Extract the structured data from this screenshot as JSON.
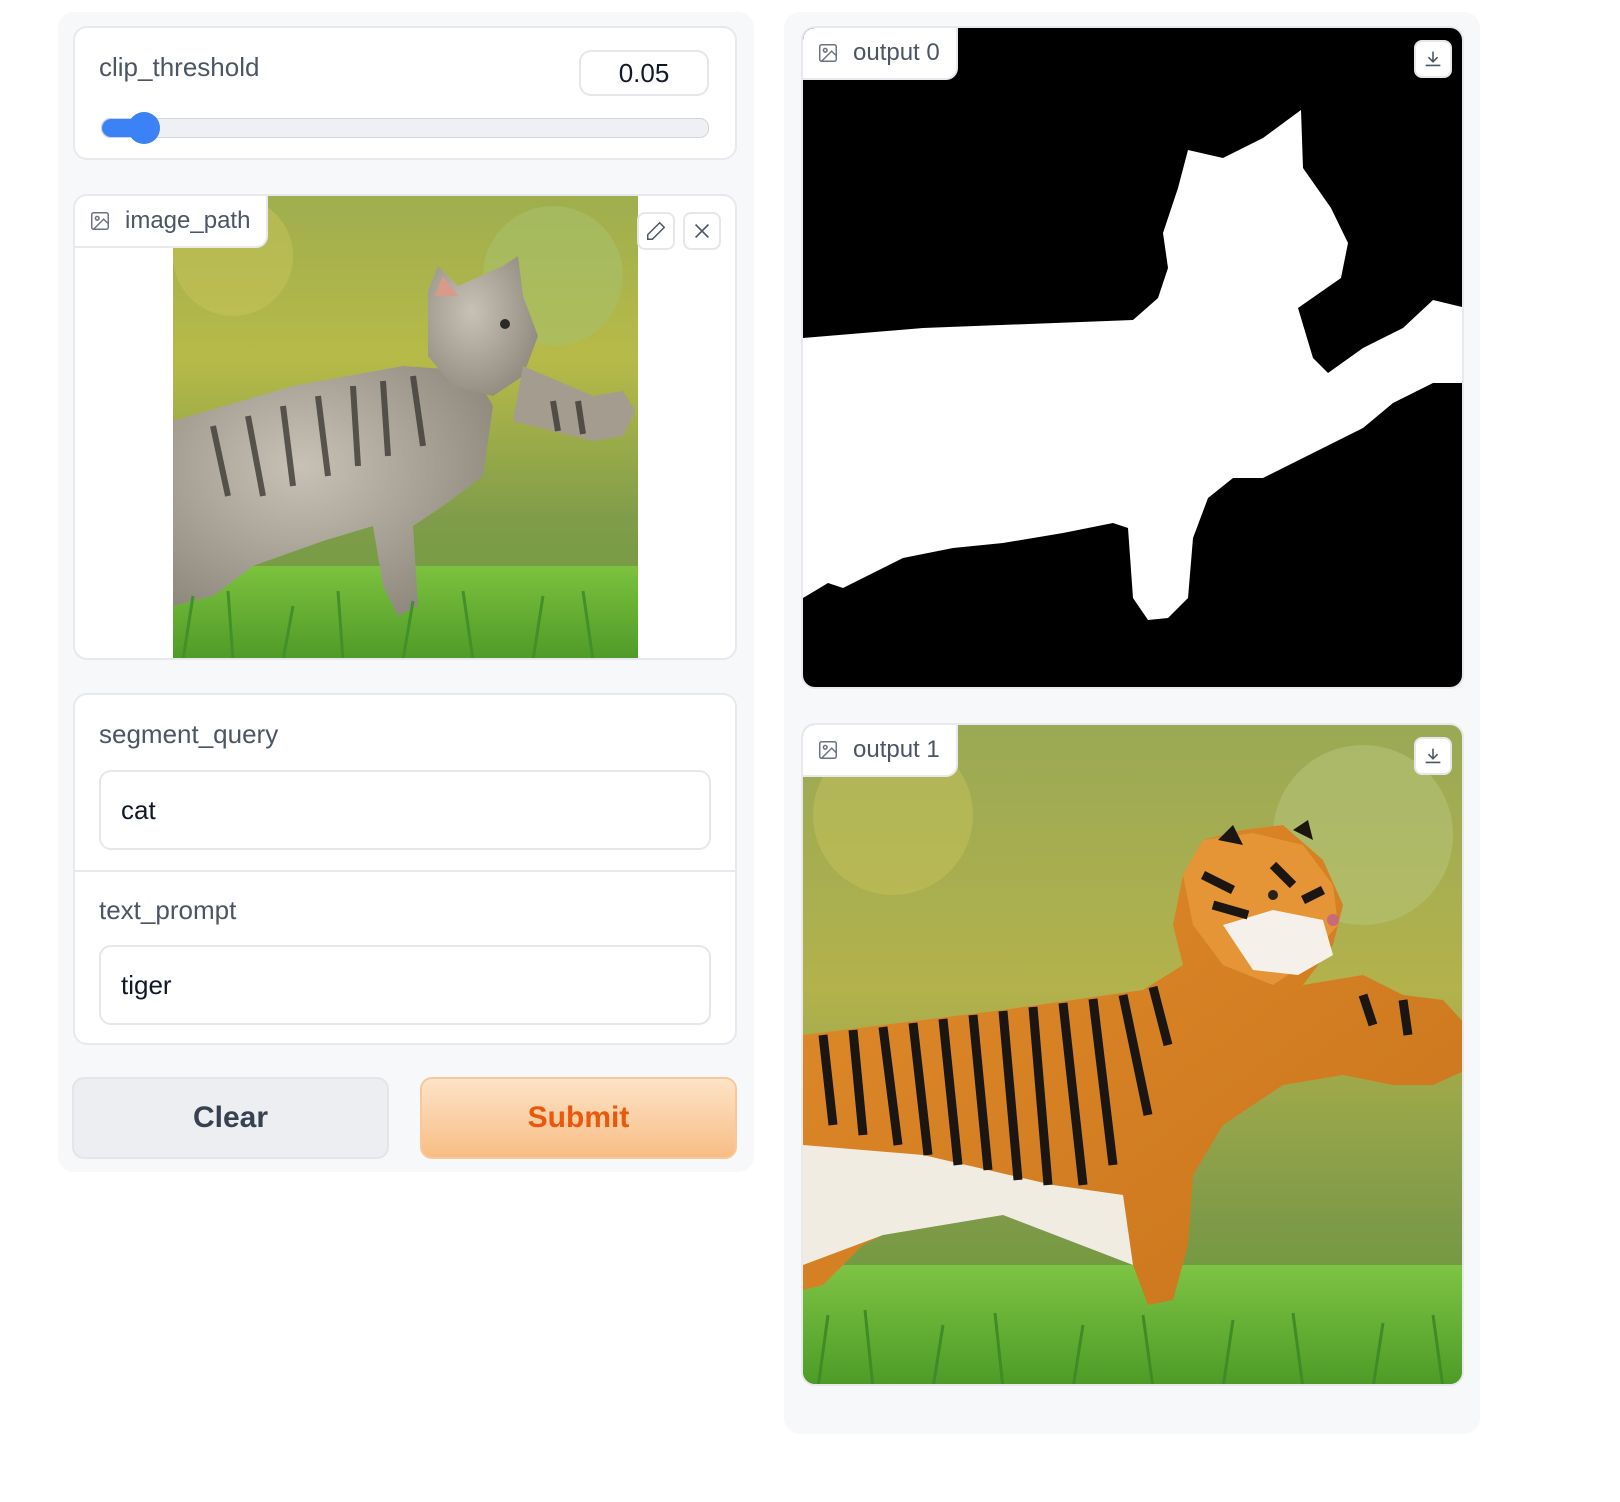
{
  "clip_threshold": {
    "label": "clip_threshold",
    "value": "0.05",
    "slider_fraction": 0.07
  },
  "image_input": {
    "label": "image_path",
    "edit_icon": "pencil-icon",
    "remove_icon": "close-icon"
  },
  "segment_query": {
    "label": "segment_query",
    "value": "cat"
  },
  "text_prompt": {
    "label": "text_prompt",
    "value": "tiger"
  },
  "buttons": {
    "clear": "Clear",
    "submit": "Submit"
  },
  "outputs": [
    {
      "label": "output 0",
      "download_icon": "download-icon"
    },
    {
      "label": "output 1",
      "download_icon": "download-icon"
    }
  ],
  "colors": {
    "accent": "#3b82f6",
    "submit_text": "#ea580c",
    "submit_bg_start": "#fde3c7",
    "submit_bg_end": "#f8bd85",
    "clear_bg": "#eceef1"
  }
}
